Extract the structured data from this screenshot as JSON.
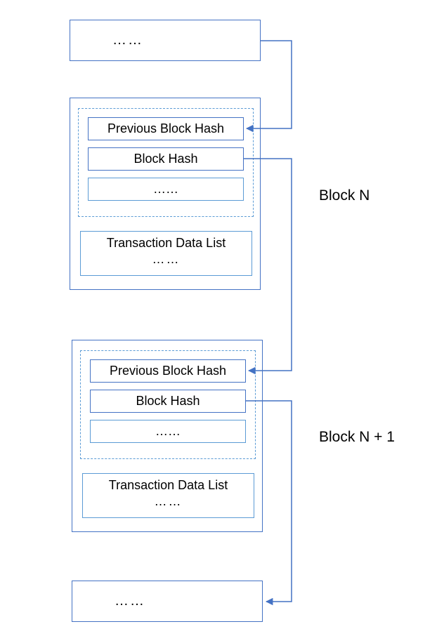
{
  "ellipsis": "……",
  "blockN": {
    "label": "Block N",
    "prevHash": "Previous Block Hash",
    "blockHash": "Block Hash",
    "spacer": "……",
    "txnTitle": "Transaction Data List",
    "txnEllipsis": "……"
  },
  "blockN1": {
    "label": "Block N + 1",
    "prevHash": "Previous Block Hash",
    "blockHash": "Block Hash",
    "spacer": "……",
    "txnTitle": "Transaction Data List",
    "txnEllipsis": "……"
  }
}
